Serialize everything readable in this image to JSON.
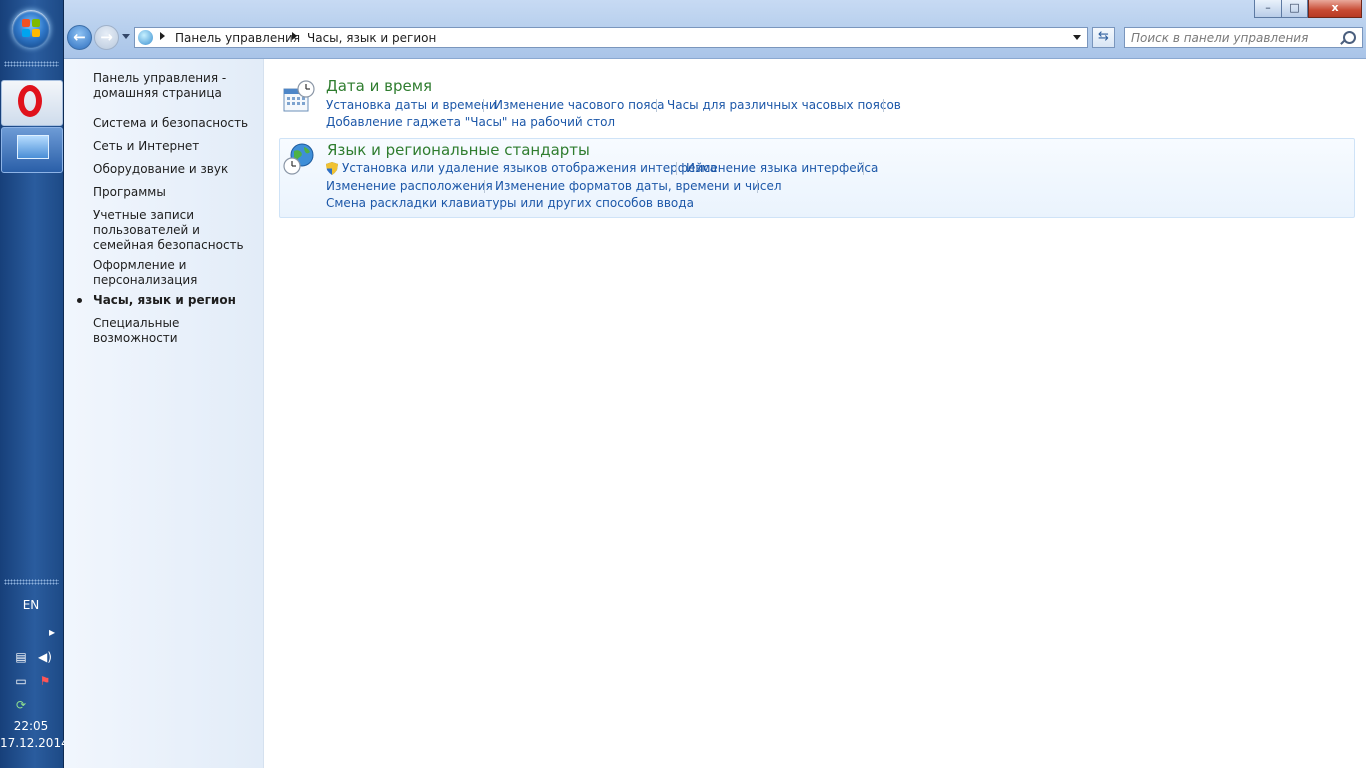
{
  "taskbar": {
    "lang": "EN",
    "time": "22:05",
    "date": "17.12.2014"
  },
  "window": {
    "caption_buttons": {
      "minimize": "–",
      "maximize": "□",
      "close": "x"
    },
    "address": {
      "crumbs": [
        "Панель управления",
        "Часы, язык и регион"
      ]
    },
    "search": {
      "placeholder": "Поиск в панели управления"
    }
  },
  "sidebar": {
    "items": [
      {
        "label": "Панель управления - домашняя страница"
      },
      {
        "label": "Система и безопасность"
      },
      {
        "label": "Сеть и Интернет"
      },
      {
        "label": "Оборудование и звук"
      },
      {
        "label": "Программы"
      },
      {
        "label": "Учетные записи пользователей и семейная безопасность"
      },
      {
        "label": "Оформление и персонализация"
      },
      {
        "label": "Часы, язык и регион",
        "current": true
      },
      {
        "label": "Специальные возможности"
      }
    ]
  },
  "content": {
    "datetime": {
      "title": "Дата и время",
      "links": [
        "Установка даты и времени",
        "Изменение часового пояса",
        "Часы для различных часовых поясов",
        "Добавление гаджета \"Часы\" на рабочий стол"
      ]
    },
    "region": {
      "title": "Язык и региональные стандарты",
      "links": [
        "Установка или удаление языков отображения интерфейса",
        "Изменение языка интерфейса",
        "Изменение расположения",
        "Изменение форматов даты, времени и чисел",
        "Смена раскладки клавиатуры или других способов ввода"
      ]
    }
  },
  "colors": {
    "link": "#1c57a8",
    "category_title": "#2f7d2f",
    "taskbar": "#2a5c9e"
  }
}
